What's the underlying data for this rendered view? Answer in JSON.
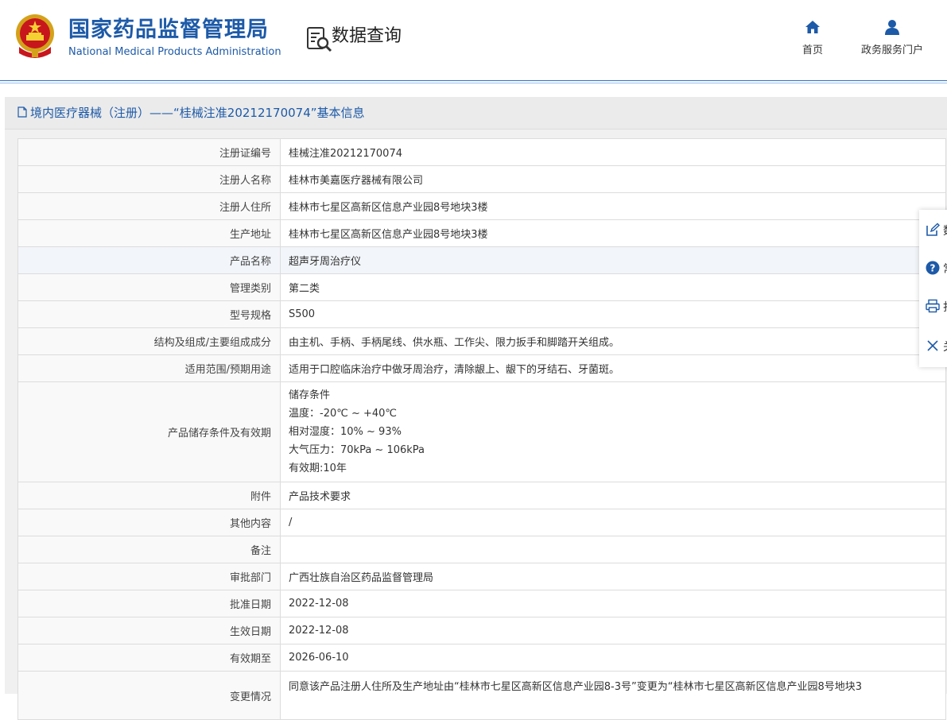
{
  "header": {
    "site_name_cn": "国家药品监督管理局",
    "site_name_en": "National Medical Products Administration",
    "section_title": "数据查询",
    "nav": [
      {
        "label": "首页",
        "icon": "home-icon"
      },
      {
        "label": "政务服务门户",
        "icon": "user-icon"
      }
    ]
  },
  "panel": {
    "title": "境内医疗器械（注册）——“桂械注准20212170074”基本信息"
  },
  "record": {
    "rows": [
      {
        "label": "注册证编号",
        "value": "桂械注准20212170074"
      },
      {
        "label": "注册人名称",
        "value": "桂林市美嘉医疗器械有限公司"
      },
      {
        "label": "注册人住所",
        "value": "桂林市七星区高新区信息产业园8号地块3楼"
      },
      {
        "label": "生产地址",
        "value": "桂林市七星区高新区信息产业园8号地块3楼"
      },
      {
        "label": "产品名称",
        "value": "超声牙周治疗仪"
      },
      {
        "label": "管理类别",
        "value": "第二类"
      },
      {
        "label": "型号规格",
        "value": "S500"
      },
      {
        "label": "结构及组成/主要组成成分",
        "value": "由主机、手柄、手柄尾线、供水瓶、工作尖、限力扳手和脚踏开关组成。"
      },
      {
        "label": "适用范围/预期用途",
        "value": "适用于口腔临床治疗中做牙周治疗，清除龈上、龈下的牙结石、牙菌斑。"
      }
    ],
    "storage": {
      "label": "产品储存条件及有效期",
      "lines": [
        "储存条件",
        "温度：-20℃ ~ +40℃",
        "相对湿度：10% ~ 93%",
        "大气压力：70kPa ~ 106kPa",
        "有效期:10年"
      ]
    },
    "rows2": [
      {
        "label": "附件",
        "value": "产品技术要求"
      },
      {
        "label": "其他内容",
        "value": "/"
      },
      {
        "label": "备注",
        "value": ""
      },
      {
        "label": "审批部门",
        "value": "广西壮族自治区药品监督管理局"
      },
      {
        "label": "批准日期",
        "value": "2022-12-08"
      },
      {
        "label": "生效日期",
        "value": "2022-12-08"
      },
      {
        "label": "有效期至",
        "value": "2026-06-10"
      },
      {
        "label": "变更情况",
        "value": "同意该产品注册人住所及生产地址由“桂林市七星区高新区信息产业园8-3号”变更为“桂林市七星区高新区信息产业园8号地块3"
      }
    ]
  },
  "float_tools": [
    {
      "icon": "edit-icon",
      "label": "数"
    },
    {
      "icon": "help-icon",
      "label": "常"
    },
    {
      "icon": "print-icon",
      "label": "打"
    },
    {
      "icon": "close-icon",
      "label": "关"
    }
  ]
}
